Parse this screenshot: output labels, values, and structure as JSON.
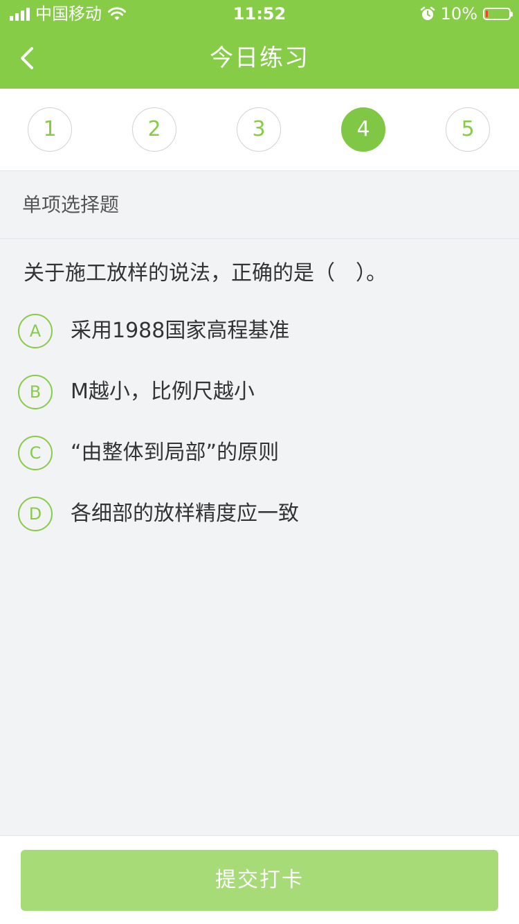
{
  "status_bar": {
    "carrier": "中国移动",
    "time": "11:52",
    "battery_text": "10%",
    "battery_level": 0.1,
    "icons": [
      "signal-icon",
      "wifi-icon",
      "alarm-icon",
      "battery-icon"
    ]
  },
  "nav": {
    "title": "今日练习",
    "back_icon": "chevron-left-icon"
  },
  "question_numbers": [
    "1",
    "2",
    "3",
    "4",
    "5"
  ],
  "active_question": "4",
  "question": {
    "type_label": "单项选择题",
    "text": "关于施工放样的说法，正确的是（　）。",
    "options": [
      {
        "letter": "A",
        "text": "采用1988国家高程基准"
      },
      {
        "letter": "B",
        "text": "M越小，比例尺越小"
      },
      {
        "letter": "C",
        "text": "“由整体到局部”的原则"
      },
      {
        "letter": "D",
        "text": "各细部的放样精度应一致"
      }
    ]
  },
  "footer": {
    "submit_label": "提交打卡"
  },
  "colors": {
    "brand_green": "#86cc47",
    "active_circle": "#7fc744",
    "submit_disabled": "#a7db78",
    "page_bg": "#f2f3f5"
  }
}
